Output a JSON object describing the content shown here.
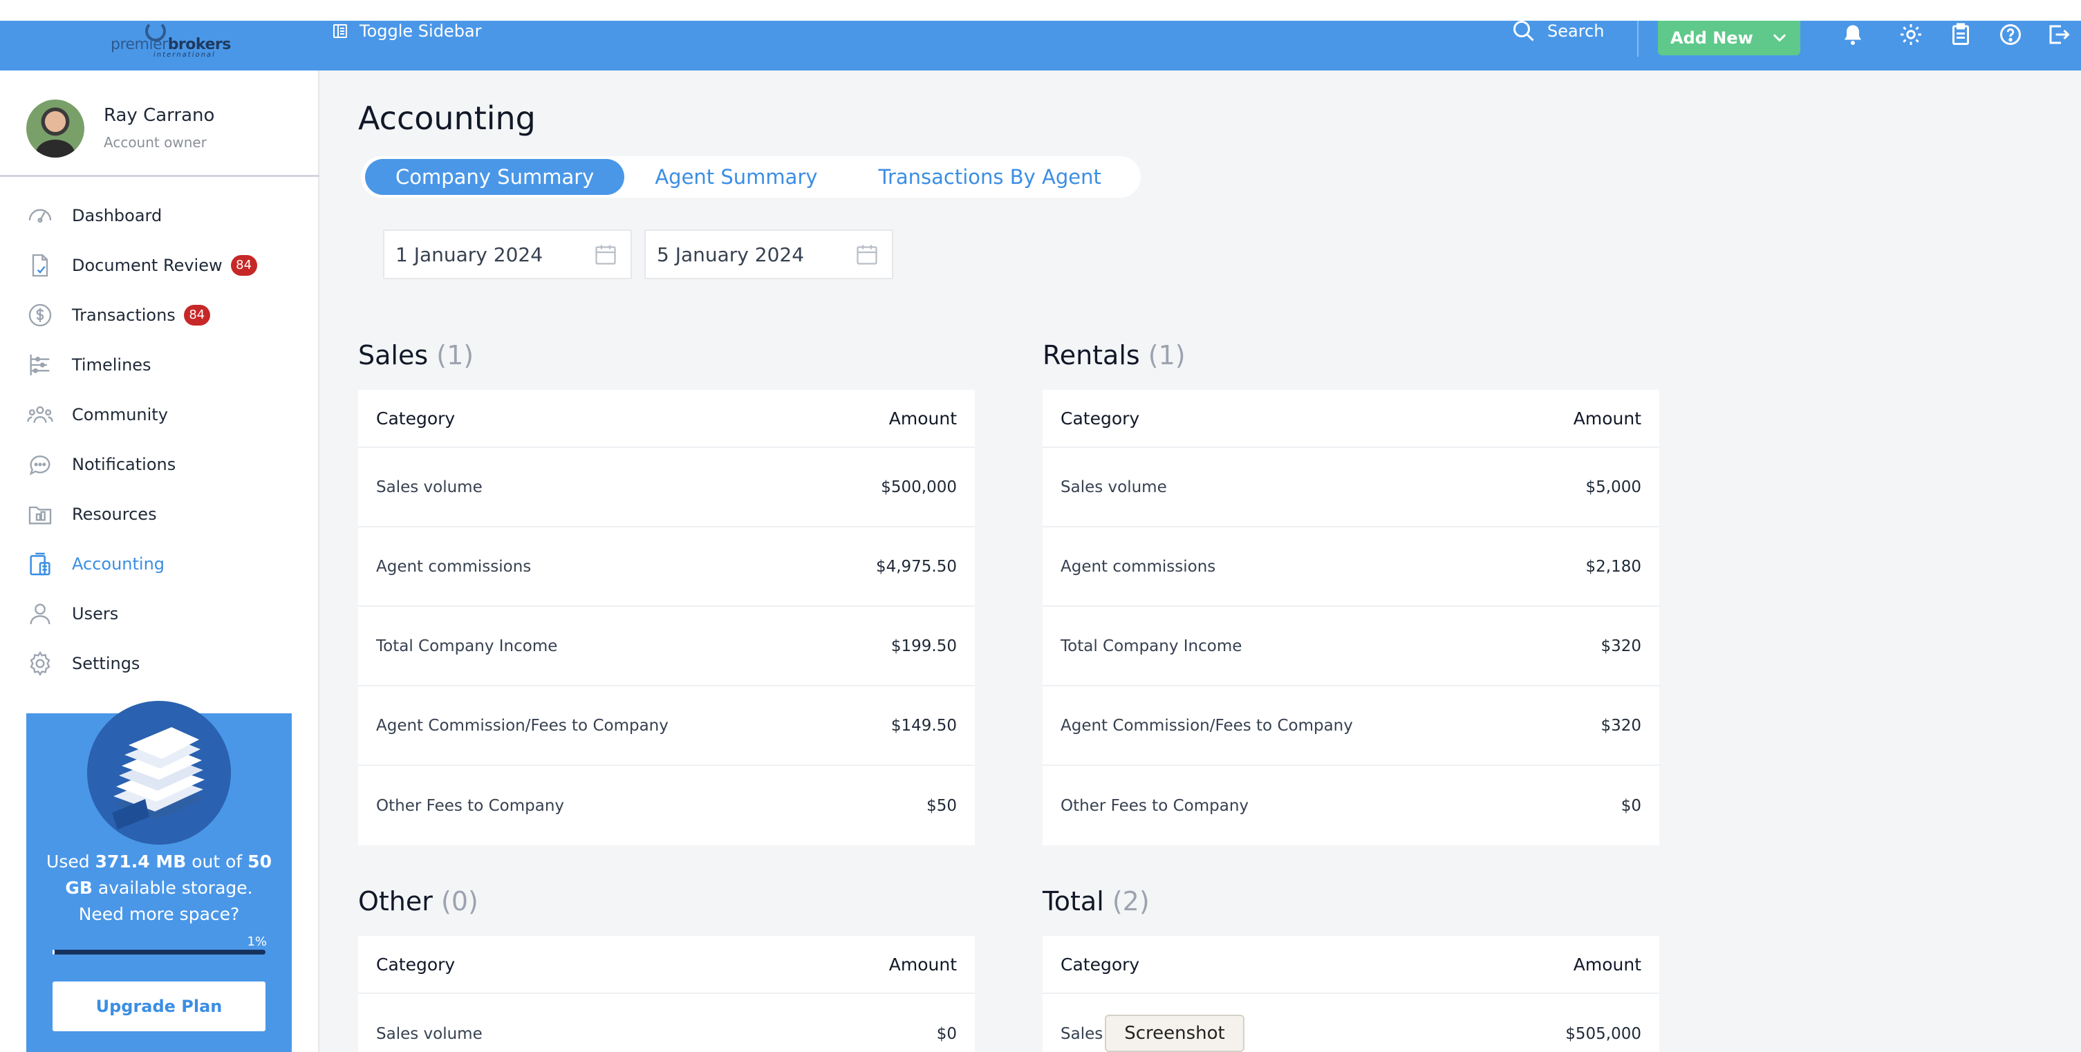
{
  "header": {
    "logo_word_a": "premier",
    "logo_word_b": "brokers",
    "logo_sub": "international",
    "toggle_sidebar": "Toggle Sidebar",
    "search": "Search",
    "add_new": "Add New"
  },
  "profile": {
    "name": "Ray Carrano",
    "role": "Account owner"
  },
  "nav": [
    {
      "label": "Dashboard",
      "icon": "gauge-icon"
    },
    {
      "label": "Document Review",
      "icon": "document-check-icon",
      "badge": "84"
    },
    {
      "label": "Transactions",
      "icon": "dollar-circle-icon",
      "badge": "84"
    },
    {
      "label": "Timelines",
      "icon": "timeline-icon"
    },
    {
      "label": "Community",
      "icon": "community-icon"
    },
    {
      "label": "Notifications",
      "icon": "chat-bubble-icon"
    },
    {
      "label": "Resources",
      "icon": "folder-icon"
    },
    {
      "label": "Accounting",
      "icon": "calculator-icon",
      "active": true
    },
    {
      "label": "Users",
      "icon": "user-icon"
    },
    {
      "label": "Settings",
      "icon": "gear-icon"
    }
  ],
  "storage": {
    "used_prefix": "Used ",
    "used": "371.4 MB",
    "middle": " out of ",
    "total": "50 GB",
    "suffix": " available storage. Need more space?",
    "percent_label": "1%",
    "percent": 1,
    "upgrade": "Upgrade Plan"
  },
  "page": {
    "title": "Accounting",
    "tabs": [
      "Company Summary",
      "Agent Summary",
      "Transactions By Agent"
    ],
    "date_from": "1 January 2024",
    "date_to": "5 January 2024"
  },
  "sections": {
    "sales": {
      "title": "Sales",
      "count": "(1)",
      "col_category": "Category",
      "col_amount": "Amount",
      "rows": [
        {
          "category": "Sales volume",
          "amount": "$500,000"
        },
        {
          "category": "Agent commissions",
          "amount": "$4,975.50"
        },
        {
          "category": "Total Company Income",
          "amount": "$199.50"
        },
        {
          "category": "Agent Commission/Fees to Company",
          "amount": "$149.50"
        },
        {
          "category": "Other Fees to Company",
          "amount": "$50"
        }
      ]
    },
    "rentals": {
      "title": "Rentals",
      "count": "(1)",
      "col_category": "Category",
      "col_amount": "Amount",
      "rows": [
        {
          "category": "Sales volume",
          "amount": "$5,000"
        },
        {
          "category": "Agent commissions",
          "amount": "$2,180"
        },
        {
          "category": "Total Company Income",
          "amount": "$320"
        },
        {
          "category": "Agent Commission/Fees to Company",
          "amount": "$320"
        },
        {
          "category": "Other Fees to Company",
          "amount": "$0"
        }
      ]
    },
    "other": {
      "title": "Other",
      "count": "(0)",
      "col_category": "Category",
      "col_amount": "Amount",
      "rows": [
        {
          "category": "Sales volume",
          "amount": "$0"
        }
      ]
    },
    "total": {
      "title": "Total",
      "count": "(2)",
      "col_category": "Category",
      "col_amount": "Amount",
      "rows": [
        {
          "category": "Sales",
          "amount": "$505,000"
        }
      ]
    }
  },
  "overlay": {
    "screenshot_tip": "Screenshot"
  },
  "colors": {
    "header_blue": "#4a97e8",
    "add_new_green": "#5ec98a",
    "badge_red": "#c62828",
    "accent_blue": "#3b8ee3"
  }
}
